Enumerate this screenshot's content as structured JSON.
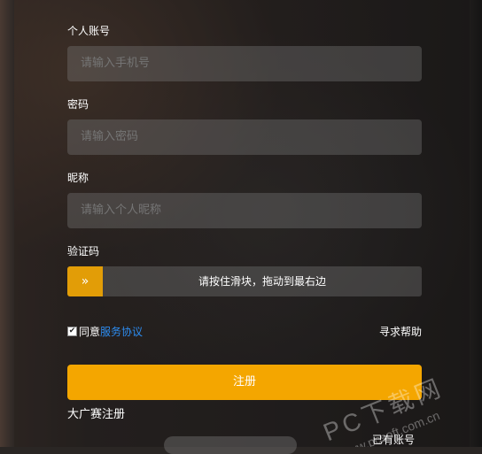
{
  "form": {
    "account_label": "个人账号",
    "account_placeholder": "请输入手机号",
    "password_label": "密码",
    "password_placeholder": "请输入密码",
    "nickname_label": "昵称",
    "nickname_placeholder": "请输入个人昵称",
    "captcha_label": "验证码",
    "slider_text": "请按住滑块，拖动到最右边",
    "slider_handle_glyph": "»",
    "agree_text": "同意",
    "agree_link": "服务协议",
    "agree_checked": true,
    "help_link": "寻求帮助",
    "register_button": "注册",
    "contest_register": "大广赛注册",
    "has_account": "已有账号"
  },
  "watermark": {
    "line1": "PC下载网",
    "line2": "www.pcsoft.com.cn"
  },
  "colors": {
    "accent": "#f4a600",
    "slider_handle": "#e29d07",
    "link": "#2d8cf0"
  },
  "icons": {
    "slider_handle": "double-chevron-right-icon",
    "checkbox": "checkbox-checked-icon"
  }
}
